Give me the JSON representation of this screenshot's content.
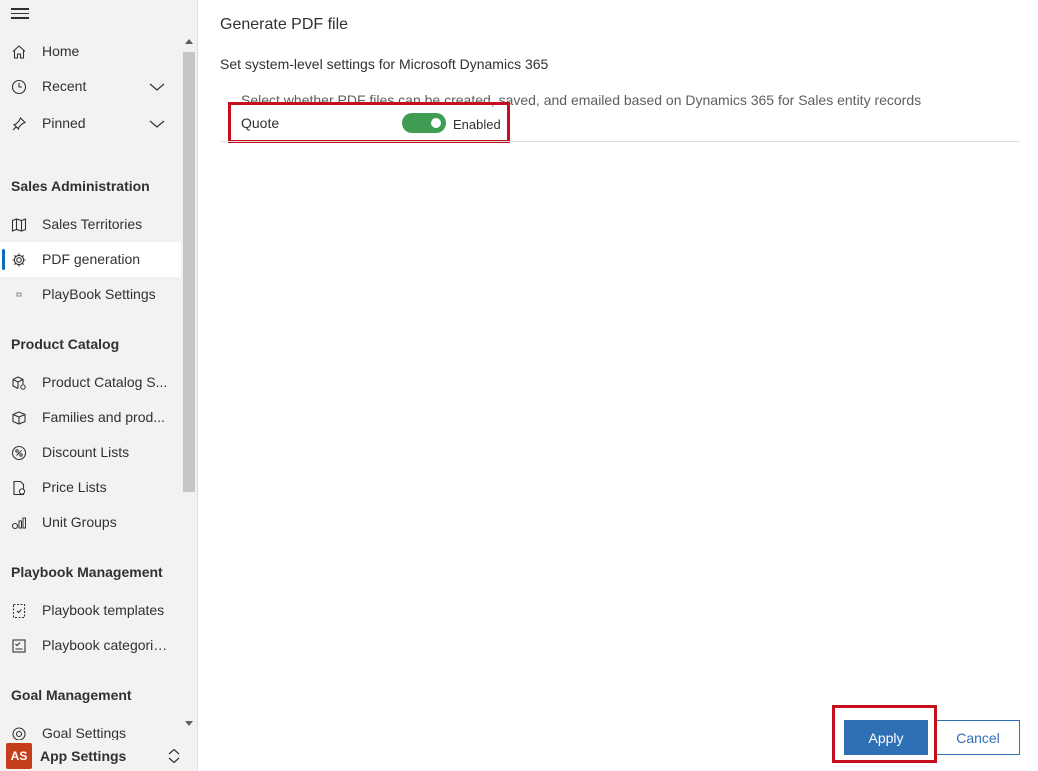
{
  "sidebar": {
    "top_items": [
      {
        "label": "Home",
        "icon": "home-icon"
      },
      {
        "label": "Recent",
        "icon": "clock-icon"
      },
      {
        "label": "Pinned",
        "icon": "pin-icon"
      }
    ],
    "sections": [
      {
        "title": "Sales Administration",
        "items": [
          {
            "label": "Sales Territories",
            "icon": "map-icon"
          },
          {
            "label": "PDF generation",
            "icon": "gear-icon",
            "selected": true
          },
          {
            "label": "PlayBook Settings",
            "icon": "small-square-icon"
          }
        ]
      },
      {
        "title": "Product Catalog",
        "items": [
          {
            "label": "Product Catalog S...",
            "icon": "product-settings-icon"
          },
          {
            "label": "Families and prod...",
            "icon": "box-icon"
          },
          {
            "label": "Discount Lists",
            "icon": "percent-icon"
          },
          {
            "label": "Price Lists",
            "icon": "price-list-icon"
          },
          {
            "label": "Unit Groups",
            "icon": "unit-groups-icon"
          }
        ]
      },
      {
        "title": "Playbook Management",
        "items": [
          {
            "label": "Playbook templates",
            "icon": "template-icon"
          },
          {
            "label": "Playbook categories",
            "icon": "checklist-icon"
          }
        ]
      },
      {
        "title": "Goal Management",
        "items": [
          {
            "label": "Goal Settings",
            "icon": "target-icon"
          }
        ]
      }
    ],
    "app": {
      "initials": "AS",
      "name": "App Settings"
    }
  },
  "main": {
    "title": "Generate PDF file",
    "subtitle": "Set system-level settings for Microsoft Dynamics 365",
    "description": "Select whether PDF files can be created, saved, and emailed based on Dynamics 365 for Sales entity records",
    "row": {
      "label": "Quote",
      "toggle_on": true,
      "toggle_state": "Enabled"
    },
    "buttons": {
      "apply": "Apply",
      "cancel": "Cancel"
    }
  },
  "colors": {
    "accent": "#2f6fb5",
    "toggle_on": "#3f9c53",
    "highlight": "#c50f1f",
    "avatar": "#c43e1c",
    "sidebar_bg": "#f3f2f1"
  }
}
